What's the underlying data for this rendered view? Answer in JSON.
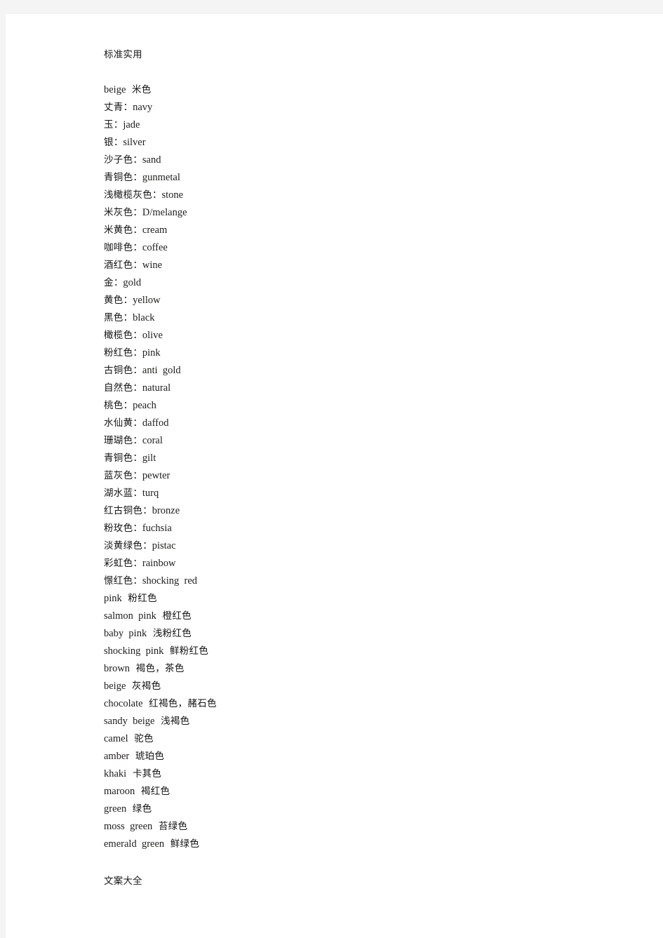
{
  "document": {
    "header": "标准实用",
    "footer": "文案大全",
    "page_background": "#f4f4f4",
    "sheet_background": "#ffffff",
    "text_color": "#1a1a1a"
  },
  "vocabulary": {
    "entries": [
      {
        "order": "en-first",
        "en": "beige",
        "sep": "  ",
        "cn": "米色"
      },
      {
        "order": "cn-first",
        "cn": "丈青",
        "sep": "：",
        "en": "navy"
      },
      {
        "order": "cn-first",
        "cn": "玉",
        "sep": "：",
        "en": "jade"
      },
      {
        "order": "cn-first",
        "cn": "银",
        "sep": "：",
        "en": "silver"
      },
      {
        "order": "cn-first",
        "cn": "沙子色",
        "sep": "：",
        "en": "sand"
      },
      {
        "order": "cn-first",
        "cn": "青铜色",
        "sep": "：",
        "en": "gunmetal"
      },
      {
        "order": "cn-first",
        "cn": "浅橄榄灰色",
        "sep": "：",
        "en": "stone"
      },
      {
        "order": "cn-first",
        "cn": "米灰色",
        "sep": "：",
        "en": "D/melange"
      },
      {
        "order": "cn-first",
        "cn": "米黄色",
        "sep": "：",
        "en": "cream"
      },
      {
        "order": "cn-first",
        "cn": "咖啡色",
        "sep": "：",
        "en": "coffee"
      },
      {
        "order": "cn-first",
        "cn": "酒红色",
        "sep": "：",
        "en": "wine"
      },
      {
        "order": "cn-first",
        "cn": "金",
        "sep": "：",
        "en": "gold"
      },
      {
        "order": "cn-first",
        "cn": "黄色",
        "sep": "：",
        "en": "yellow"
      },
      {
        "order": "cn-first",
        "cn": "黑色",
        "sep": "：",
        "en": "black"
      },
      {
        "order": "cn-first",
        "cn": "橄榄色",
        "sep": "：",
        "en": "olive"
      },
      {
        "order": "cn-first",
        "cn": "粉红色",
        "sep": "：",
        "en": "pink"
      },
      {
        "order": "cn-first",
        "cn": "古铜色",
        "sep": "：",
        "en": "anti  gold"
      },
      {
        "order": "cn-first",
        "cn": "自然色",
        "sep": "：",
        "en": "natural"
      },
      {
        "order": "cn-first",
        "cn": "桃色",
        "sep": "：",
        "en": "peach"
      },
      {
        "order": "cn-first",
        "cn": "水仙黄",
        "sep": "：",
        "en": "daffod"
      },
      {
        "order": "cn-first",
        "cn": "珊瑚色",
        "sep": "：",
        "en": "coral"
      },
      {
        "order": "cn-first",
        "cn": "青铜色",
        "sep": "：",
        "en": "gilt"
      },
      {
        "order": "cn-first",
        "cn": "蓝灰色",
        "sep": "：",
        "en": "pewter"
      },
      {
        "order": "cn-first",
        "cn": "湖水蓝",
        "sep": "：",
        "en": "turq"
      },
      {
        "order": "cn-first",
        "cn": "红古铜色",
        "sep": "：",
        "en": "bronze"
      },
      {
        "order": "cn-first",
        "cn": "粉玫色",
        "sep": "：",
        "en": "fuchsia"
      },
      {
        "order": "cn-first",
        "cn": "淡黄绿色",
        "sep": "：",
        "en": "pistac"
      },
      {
        "order": "cn-first",
        "cn": "彩虹色",
        "sep": "：",
        "en": "rainbow"
      },
      {
        "order": "cn-first",
        "cn": "憬红色",
        "sep": "：",
        "en": "shocking  red"
      },
      {
        "order": "en-first",
        "en": "pink",
        "sep": "  ",
        "cn": "粉红色"
      },
      {
        "order": "en-first",
        "en": "salmon  pink",
        "sep": "  ",
        "cn": "橙红色"
      },
      {
        "order": "en-first",
        "en": "baby  pink",
        "sep": "  ",
        "cn": "浅粉红色"
      },
      {
        "order": "en-first",
        "en": "shocking  pink",
        "sep": "  ",
        "cn": "鲜粉红色"
      },
      {
        "order": "en-first",
        "en": "brown",
        "sep": "  ",
        "cn": "褐色，茶色"
      },
      {
        "order": "en-first",
        "en": "beige",
        "sep": "  ",
        "cn": "灰褐色"
      },
      {
        "order": "en-first",
        "en": "chocolate",
        "sep": "  ",
        "cn": "红褐色，赭石色"
      },
      {
        "order": "en-first",
        "en": "sandy  beige",
        "sep": "  ",
        "cn": "浅褐色"
      },
      {
        "order": "en-first",
        "en": "camel",
        "sep": "  ",
        "cn": "驼色"
      },
      {
        "order": "en-first",
        "en": "amber",
        "sep": "  ",
        "cn": "琥珀色"
      },
      {
        "order": "en-first",
        "en": "khaki",
        "sep": "  ",
        "cn": "卡其色"
      },
      {
        "order": "en-first",
        "en": "maroon",
        "sep": "  ",
        "cn": "褐红色"
      },
      {
        "order": "en-first",
        "en": "green",
        "sep": "  ",
        "cn": "绿色"
      },
      {
        "order": "en-first",
        "en": "moss  green",
        "sep": "  ",
        "cn": "苔绿色"
      },
      {
        "order": "en-first",
        "en": "emerald  green",
        "sep": "  ",
        "cn": "鲜绿色"
      }
    ]
  }
}
